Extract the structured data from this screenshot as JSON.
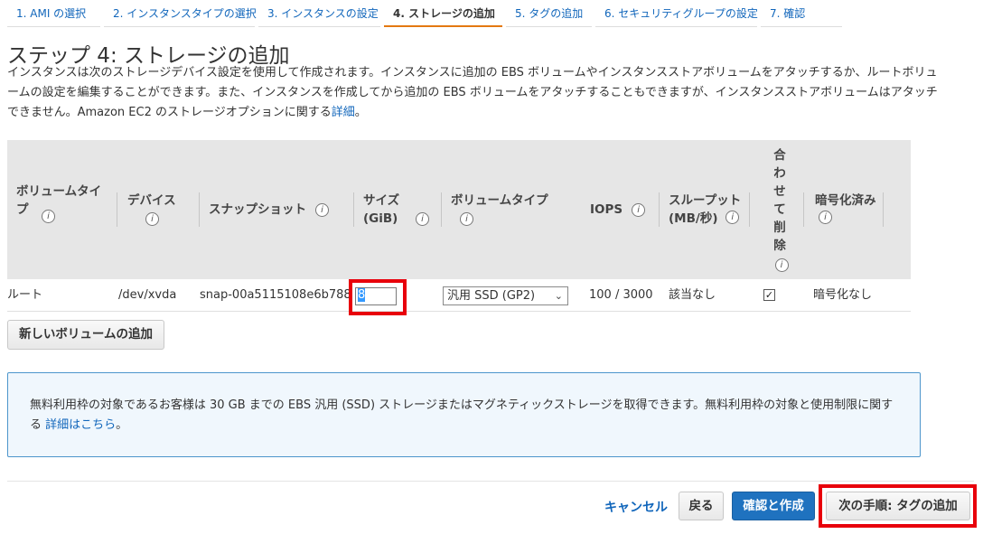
{
  "steps": [
    {
      "label": "1. AMI の選択"
    },
    {
      "label": "2. インスタンスタイプの選択"
    },
    {
      "label": "3. インスタンスの設定"
    },
    {
      "label": "4. ストレージの追加"
    },
    {
      "label": "5. タグの追加"
    },
    {
      "label": "6. セキュリティグループの設定"
    },
    {
      "label": "7. 確認"
    }
  ],
  "page": {
    "title": "ステップ 4: ストレージの追加",
    "description": "インスタンスは次のストレージデバイス設定を使用して作成されます。インスタンスに追加の EBS ボリュームやインスタンスストアボリュームをアタッチするか、ルートボリュームの設定を編集することができます。また、インスタンスを作成してから追加の EBS ボリュームをアタッチすることもできますが、インスタンスストアボリュームはアタッチできません。Amazon EC2 のストレージオプションに関する",
    "details_link": "詳細",
    "description_end": "。"
  },
  "table": {
    "headers": {
      "volume_type": "ボリュームタイプ",
      "device": "デバイス",
      "snapshot": "スナップショット",
      "size": "サイズ (GiB)",
      "volume_type2": "ボリュームタイプ",
      "iops": "IOPS",
      "throughput": "スループット (MB/秒)",
      "delete_on_termination": "合わせて削除",
      "encryption": "暗号化済み"
    },
    "row": {
      "volume_type": "ルート",
      "device": "/dev/xvda",
      "snapshot": "snap-00a5115108e6b788",
      "size": "8",
      "volume_type_select": "汎用 SSD (GP2)",
      "iops": "100 / 3000",
      "throughput": "該当なし",
      "delete_on_termination": true,
      "encryption": "暗号化なし"
    },
    "info_glyph": "i"
  },
  "add_volume_button": "新しいボリュームの追加",
  "notice": {
    "text": "無料利用枠の対象であるお客様は 30 GB までの EBS 汎用 (SSD) ストレージまたはマグネティックストレージを取得できます。無料利用枠の対象と使用制限に関する",
    "link": "詳細はこちら",
    "end": "。"
  },
  "footer": {
    "cancel": "キャンセル",
    "back": "戻る",
    "review_launch": "確認と作成",
    "next": "次の手順: タグの追加"
  },
  "colors": {
    "accent": "#e47911",
    "link": "#1166bb",
    "primary_button": "#1f72bf",
    "highlight": "#e8000b"
  }
}
